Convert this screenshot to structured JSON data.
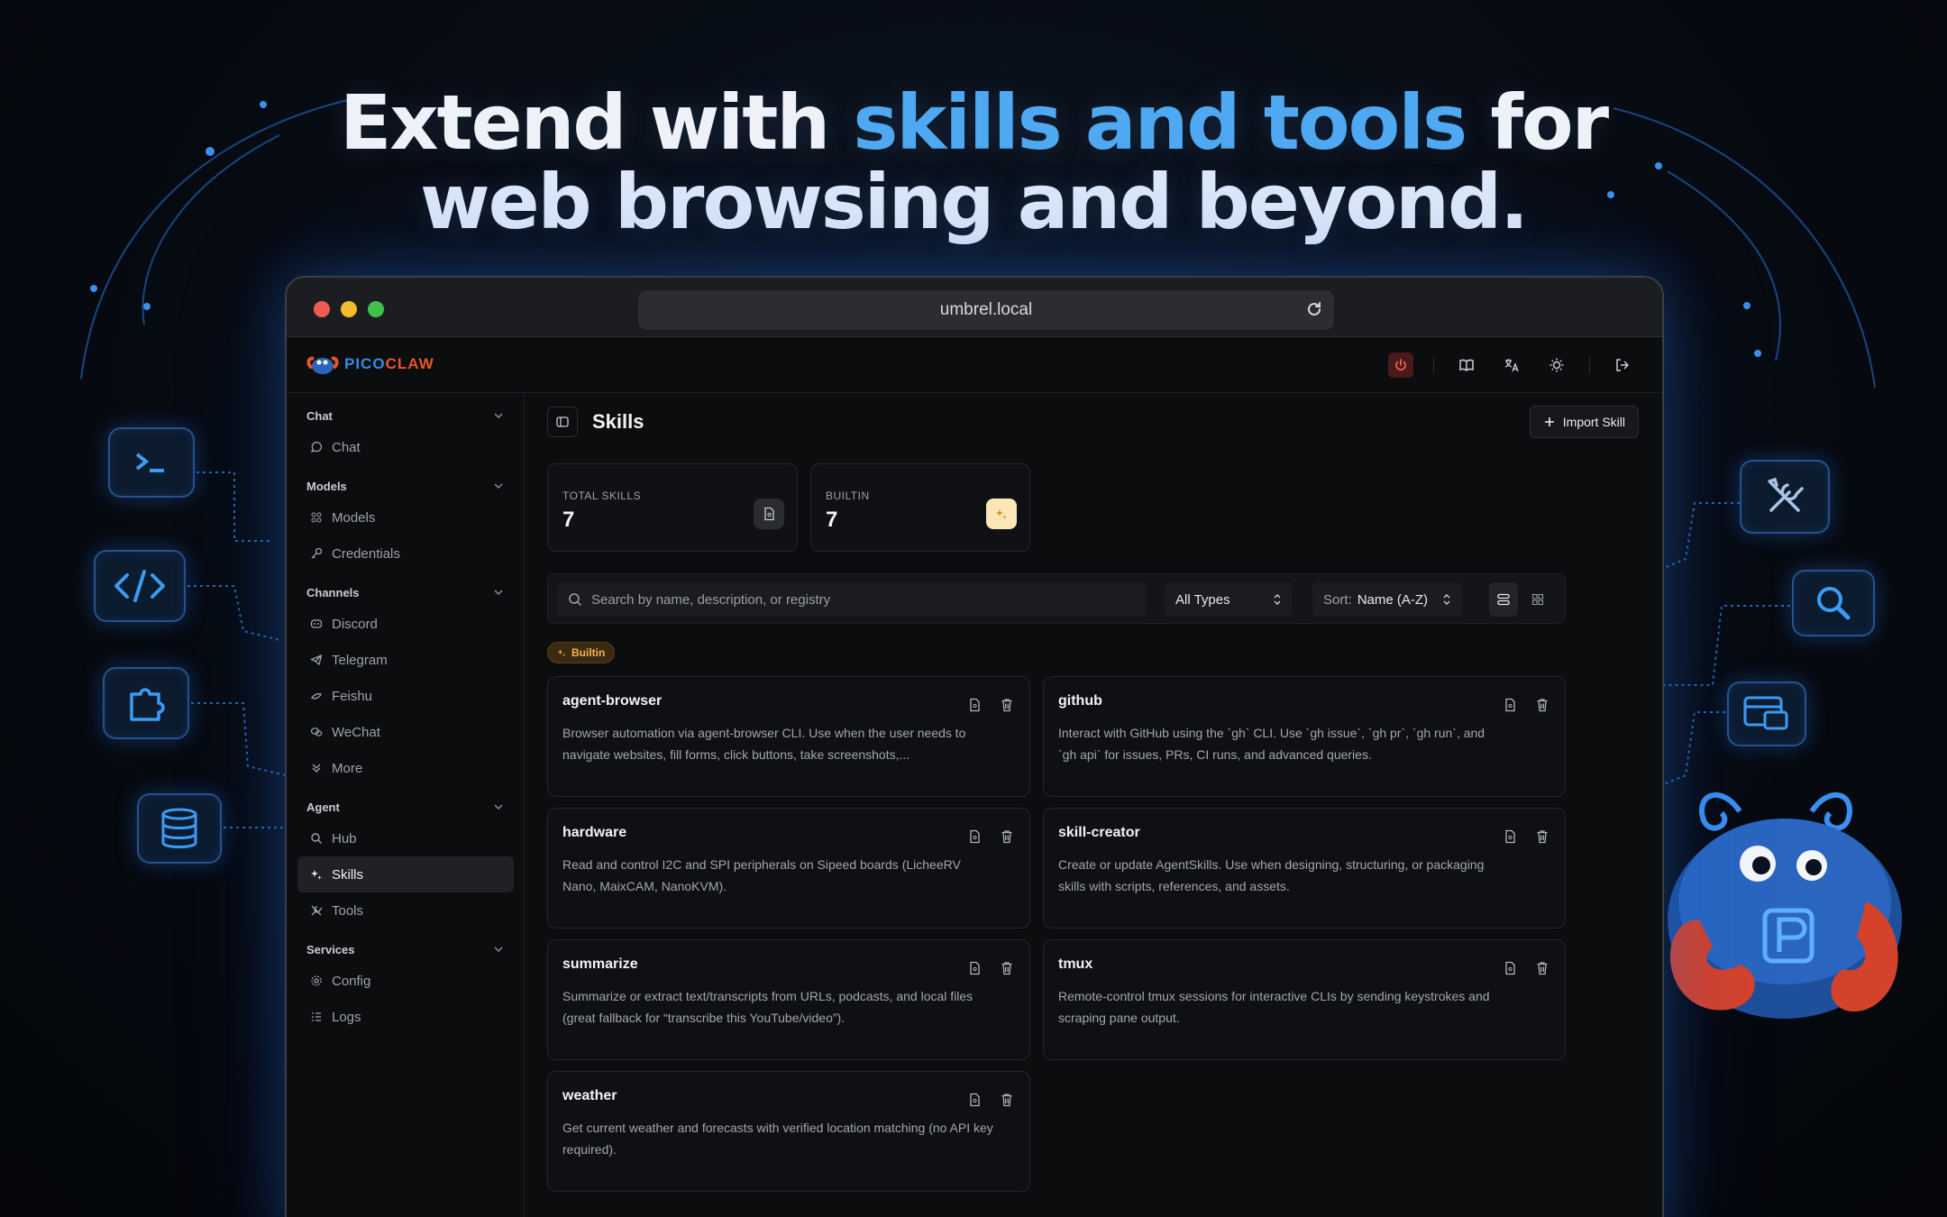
{
  "hero": {
    "line1_start": "Extend with ",
    "line1_accent": "skills and tools",
    "line1_end": " for",
    "line2": "web browsing and beyond."
  },
  "browser": {
    "url": "umbrel.local"
  },
  "app": {
    "logo_part1": "PICO",
    "logo_part2": "CLAW",
    "brand_colors": {
      "blue": "#2f8ee8",
      "orange": "#e8552b"
    }
  },
  "sidebar": {
    "chat": {
      "title": "Chat",
      "items": [
        "Chat"
      ]
    },
    "models": {
      "title": "Models",
      "items": [
        "Models",
        "Credentials"
      ]
    },
    "channels": {
      "title": "Channels",
      "items": [
        "Discord",
        "Telegram",
        "Feishu",
        "WeChat",
        "More"
      ]
    },
    "agent": {
      "title": "Agent",
      "items": [
        "Hub",
        "Skills",
        "Tools"
      ],
      "active": "Skills"
    },
    "services": {
      "title": "Services",
      "items": [
        "Config",
        "Logs"
      ]
    }
  },
  "page": {
    "title": "Skills",
    "import_label": "Import Skill"
  },
  "stats": {
    "total_label": "TOTAL SKILLS",
    "total_value": "7",
    "builtin_label": "BUILTIN",
    "builtin_value": "7"
  },
  "filters": {
    "search_placeholder": "Search by name, description, or registry",
    "type_value": "All Types",
    "sort_prefix": "Sort:",
    "sort_value": "Name (A-Z)"
  },
  "section_badge": "Builtin",
  "skills": [
    {
      "name": "agent-browser",
      "desc": "Browser automation via agent-browser CLI. Use when the user needs to navigate websites, fill forms, click buttons, take screenshots,..."
    },
    {
      "name": "github",
      "desc": "Interact with GitHub using the `gh` CLI. Use `gh issue`, `gh pr`, `gh run`, and `gh api` for issues, PRs, CI runs, and advanced queries."
    },
    {
      "name": "hardware",
      "desc": "Read and control I2C and SPI peripherals on Sipeed boards (LicheeRV Nano, MaixCAM, NanoKVM)."
    },
    {
      "name": "skill-creator",
      "desc": "Create or update AgentSkills. Use when designing, structuring, or packaging skills with scripts, references, and assets."
    },
    {
      "name": "summarize",
      "desc": "Summarize or extract text/transcripts from URLs, podcasts, and local files (great fallback for “transcribe this YouTube/video”)."
    },
    {
      "name": "tmux",
      "desc": "Remote-control tmux sessions for interactive CLIs by sending keystrokes and scraping pane output."
    },
    {
      "name": "weather",
      "desc": "Get current weather and forecasts with verified location matching (no API key required)."
    }
  ]
}
